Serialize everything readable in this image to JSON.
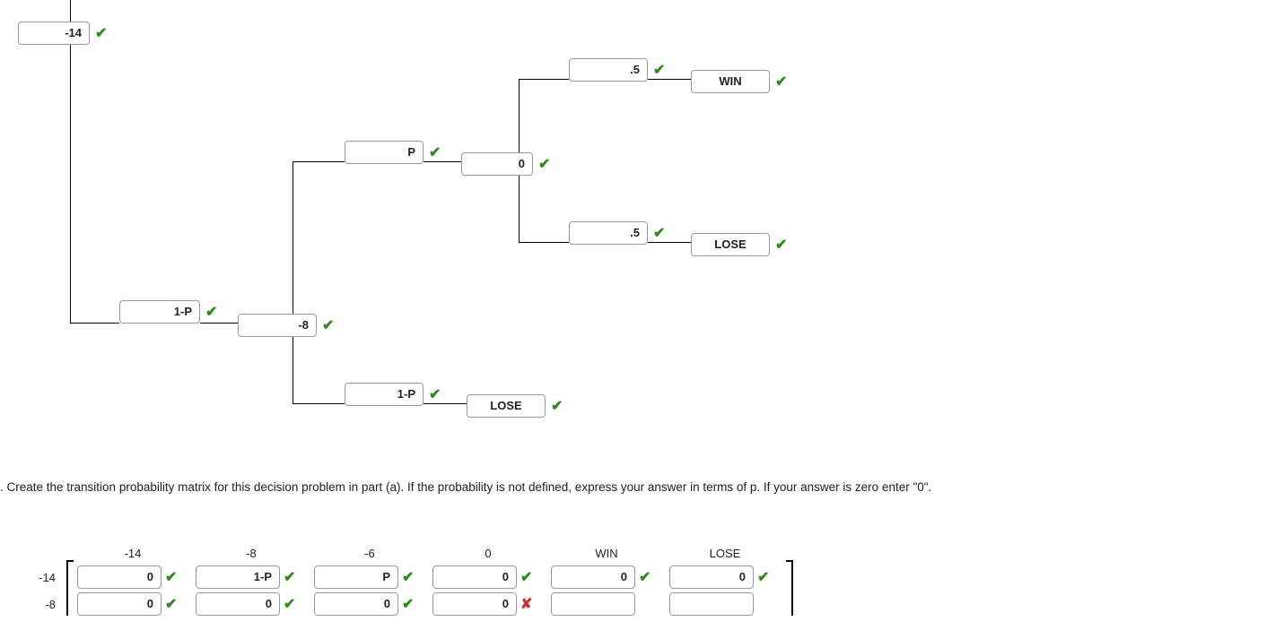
{
  "tree": {
    "root": "-14",
    "branch_1p_label": "1-P",
    "branch_1p_value": "-8",
    "p_label": "P",
    "p_value": "0",
    "p_up_prob": ".5",
    "p_up_result": "WIN",
    "p_down_prob": ".5",
    "p_down_result": "LOSE",
    "onep_label": "1-P",
    "onep_result": "LOSE"
  },
  "question": ". Create the transition probability matrix for this decision problem in part (a). If the probability is not defined, express your answer in terms of p. If your answer is zero enter \"0\".",
  "matrix": {
    "col_headers": [
      "-14",
      "-8",
      "-6",
      "0",
      "WIN",
      "LOSE"
    ],
    "rows": [
      {
        "label": "-14",
        "cells": [
          {
            "value": "0",
            "mark": "check"
          },
          {
            "value": "1-P",
            "mark": "check"
          },
          {
            "value": "P",
            "mark": "check"
          },
          {
            "value": "0",
            "mark": "check"
          },
          {
            "value": "0",
            "mark": "check"
          },
          {
            "value": "0",
            "mark": "check"
          }
        ]
      },
      {
        "label": "-8",
        "cells": [
          {
            "value": "0",
            "mark": "check"
          },
          {
            "value": "0",
            "mark": "check"
          },
          {
            "value": "0",
            "mark": "check"
          },
          {
            "value": "0",
            "mark": "cross"
          },
          {
            "value": "",
            "mark": ""
          },
          {
            "value": "",
            "mark": ""
          }
        ]
      }
    ]
  }
}
